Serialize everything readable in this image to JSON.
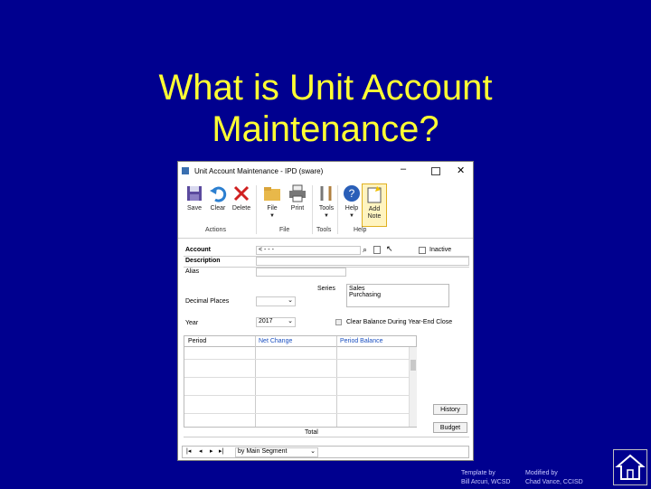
{
  "slide": {
    "title_line1": "What is Unit Account",
    "title_line2": "Maintenance?",
    "credit_left_line1": "Template by",
    "credit_left_line2": "Bill Arcuri, WCSD",
    "credit_right_line1": "Modified by",
    "credit_right_line2": "Chad Vance, CCISD"
  },
  "window": {
    "title": "Unit Account Maintenance - IPD (sware)",
    "minimize": "–",
    "close": "✕"
  },
  "ribbon": {
    "save": "Save",
    "clear": "Clear",
    "delete": "Delete",
    "file": "File",
    "print": "Print",
    "tools": "Tools",
    "help": "Help",
    "add_note_line1": "Add",
    "add_note_line2": "Note",
    "groups": {
      "actions": "Actions",
      "file": "File",
      "tools": "Tools",
      "help": "Help"
    }
  },
  "form": {
    "account_label": "Account",
    "account_value": "< - - -",
    "inactive_label": "Inactive",
    "description_label": "Description",
    "alias_label": "Alias",
    "decimal_places_label": "Decimal Places",
    "series_label": "Series",
    "series_options": [
      "Sales",
      "Purchasing"
    ],
    "year_label": "Year",
    "year_value": "2017",
    "clear_balance_label": "Clear Balance During Year-End Close"
  },
  "grid": {
    "columns": [
      "Period",
      "Net Change",
      "Period Balance"
    ],
    "total_label": "Total"
  },
  "buttons": {
    "history": "History",
    "budget": "Budget"
  },
  "navbar": {
    "sort": "by Main Segment"
  },
  "colors": {
    "background": "#00008f",
    "title": "#ffff33",
    "column_header": "#1a4fc0"
  }
}
